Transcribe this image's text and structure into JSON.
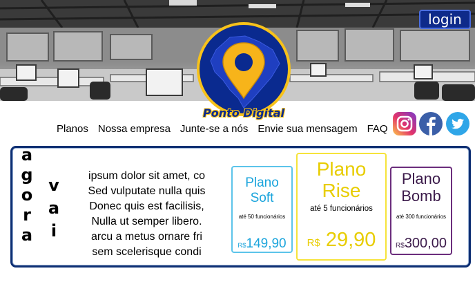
{
  "header": {
    "login_label": "login",
    "brand_text": "Ponto Digital"
  },
  "nav": {
    "items": [
      "Planos",
      "Nossa empresa",
      "Junte-se a nós",
      "Envie sua mensagem",
      "FAQ"
    ]
  },
  "social": {
    "icons": [
      "instagram-icon",
      "facebook-icon",
      "twitter-icon"
    ]
  },
  "main": {
    "vertical_word_1": "agora",
    "vertical_word_2": "vai",
    "lorem_lines": [
      "ipsum dolor sit amet, co",
      "Sed vulputate nulla quis",
      "Donec quis est facilisis,",
      "Nulla ut semper libero.",
      "arcu a metus ornare fri",
      "sem scelerisque condi"
    ]
  },
  "plans": {
    "soft": {
      "name_1": "Plano",
      "name_2": "Soft",
      "desc": "até 50 funcionários",
      "currency": "R$",
      "price": "149,90"
    },
    "rise": {
      "name_1": "Plano",
      "name_2": "Rise",
      "desc": "até 5 funcionários",
      "currency": "R$",
      "price": "29,90"
    },
    "bomb": {
      "name_1": "Plano",
      "name_2": "Bomb",
      "desc": "até 300 funcionários",
      "currency": "R$",
      "price": "300,00"
    }
  },
  "colors": {
    "brand_blue": "#0e2a8a",
    "logo_yellow": "#f7c21a",
    "soft_blue": "#1aa4dc",
    "rise_yellow": "#e8cd00",
    "bomb_purple": "#3b1a4a"
  }
}
